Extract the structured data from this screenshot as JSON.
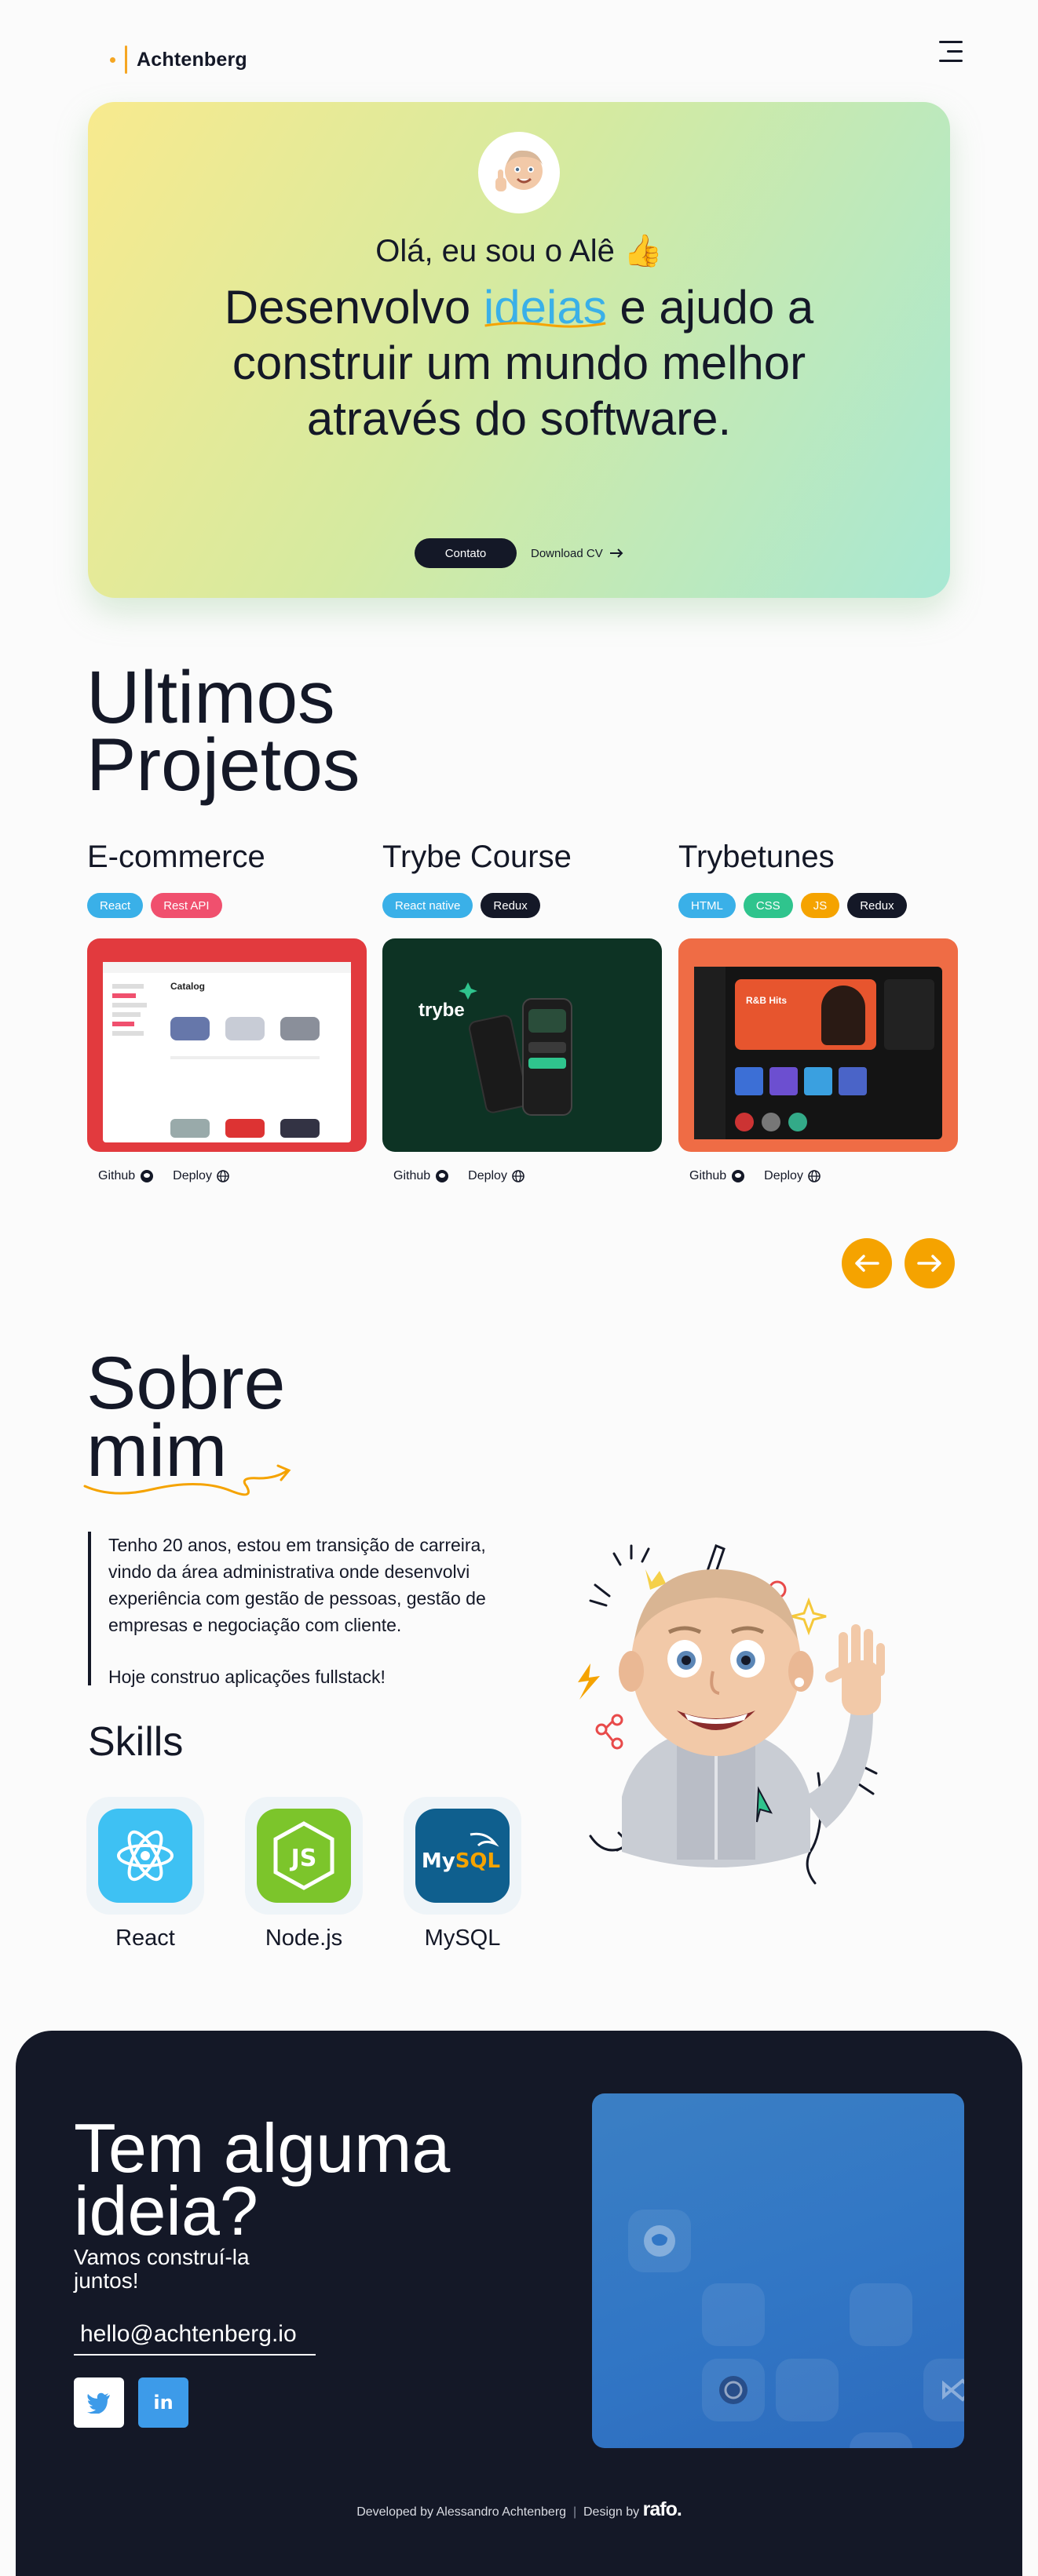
{
  "header": {
    "logo_text": "Achtenberg",
    "menu_icon": "hamburger-menu-icon"
  },
  "hero": {
    "avatar_icon": "memoji-thumbs-up-avatar-icon",
    "greeting": "Olá, eu sou o Alê 👍",
    "title_before": "Desenvolvo ",
    "title_highlight": "ideias",
    "title_after": " e ajudo a construir um mundo melhor através do software.",
    "contact_label": "Contato",
    "download_label": "Download CV",
    "highlight_color": "#3ab0e8"
  },
  "projects": {
    "title_line1": "Ultimos",
    "title_line2": "Projetos",
    "items": [
      {
        "name": "E-commerce",
        "tags": [
          {
            "label": "React",
            "color": "#3ab0e8"
          },
          {
            "label": "Rest API",
            "color": "#f0506e"
          }
        ],
        "thumb_color": "#e23a3e",
        "github_label": "Github",
        "deploy_label": "Deploy",
        "screen_title": "Catalog"
      },
      {
        "name": "Trybe Course",
        "tags": [
          {
            "label": "React native",
            "color": "#3ab0e8"
          },
          {
            "label": "Redux",
            "color": "#141827"
          }
        ],
        "thumb_color": "#0d3324",
        "github_label": "Github",
        "deploy_label": "Deploy",
        "screen_title": "trybe"
      },
      {
        "name": "Trybetunes",
        "tags": [
          {
            "label": "HTML",
            "color": "#3ab0e8"
          },
          {
            "label": "CSS",
            "color": "#2fc48d"
          },
          {
            "label": "JS",
            "color": "#f5a300"
          },
          {
            "label": "Redux",
            "color": "#141827"
          }
        ],
        "thumb_color": "#ef6c45",
        "github_label": "Github",
        "deploy_label": "Deploy",
        "screen_title": "R&B Hits"
      }
    ],
    "prev_icon": "arrow-left-icon",
    "next_icon": "arrow-right-icon",
    "arrow_color": "#f5a300"
  },
  "about": {
    "title_line1": "Sobre",
    "title_line2": "mim",
    "paragraph1": "Tenho 20 anos, estou em transição de carreira, vindo da área administrativa onde desenvolvi experiência com gestão de pessoas, gestão de empresas e negociação com cliente.",
    "paragraph2": "Hoje construo aplicações fullstack!",
    "skills_title": "Skills",
    "skills": [
      {
        "name": "React",
        "icon": "react-icon",
        "color": "#3ec1f3"
      },
      {
        "name": "Node.js",
        "icon": "nodejs-icon",
        "color": "#7cc52b"
      },
      {
        "name": "MySQL",
        "icon": "mysql-icon",
        "color": "#0f5f8e"
      }
    ],
    "mascot_icon": "memoji-waving-mascot-icon"
  },
  "footer": {
    "title_line1": "Tem alguma",
    "title_line2": "ideia?",
    "subtitle": "Vamos construí-la juntos!",
    "email": "hello@achtenberg.io",
    "social": [
      {
        "icon": "twitter-icon",
        "color": "#ffffff"
      },
      {
        "icon": "linkedin-icon",
        "color": "#3d9be9"
      }
    ],
    "credit_text": "Developed by Alessandro Achtenberg",
    "credit_separator": "|",
    "credit_design": "Design by",
    "credit_brand": "rafo.",
    "background": "#141827"
  }
}
